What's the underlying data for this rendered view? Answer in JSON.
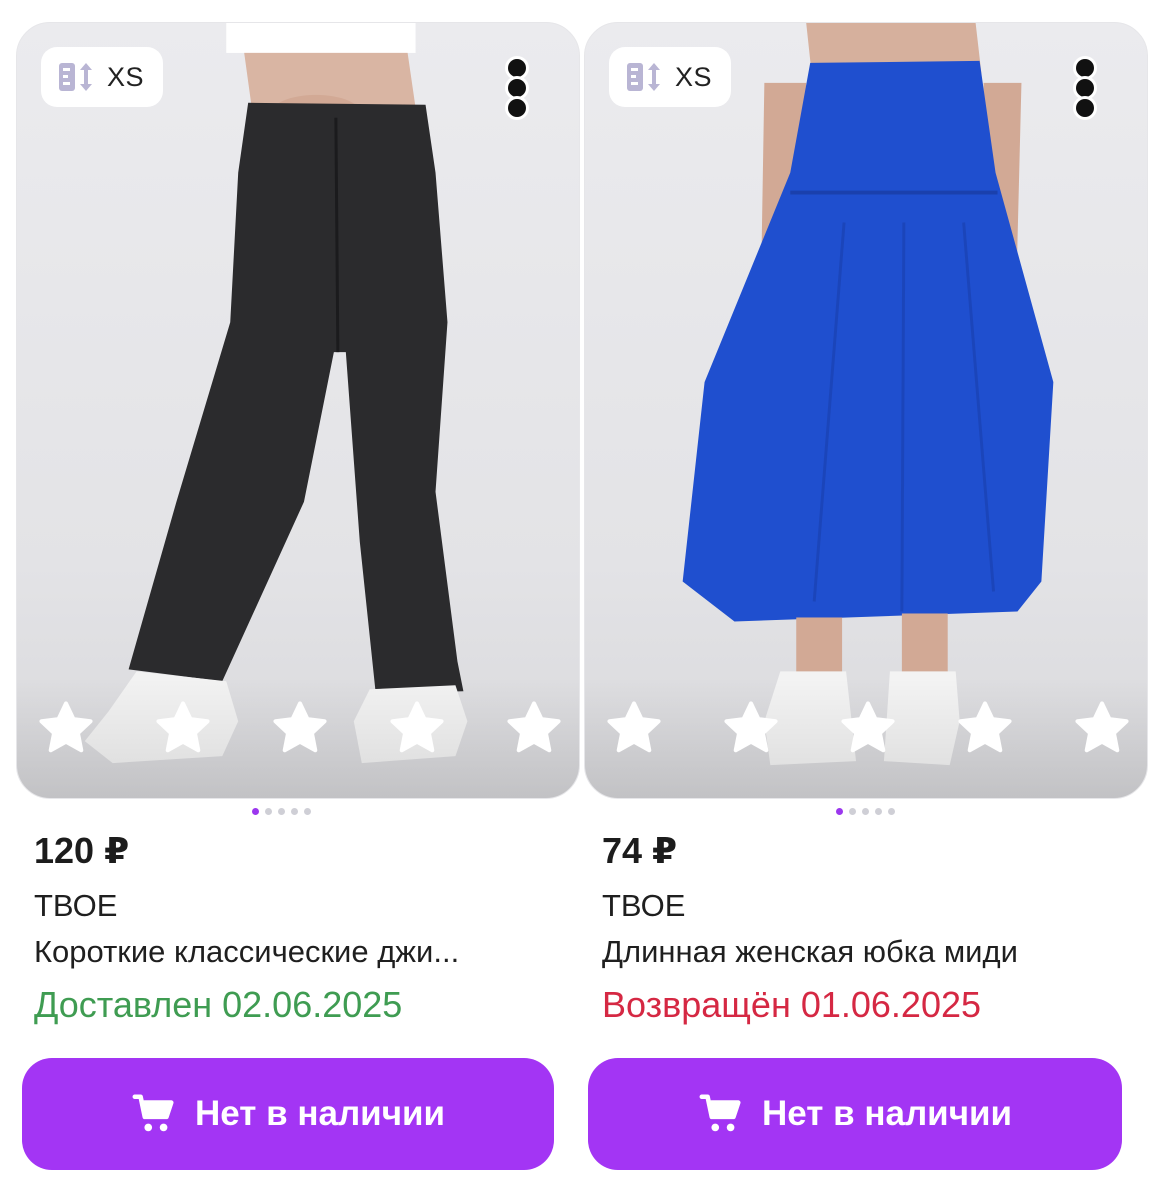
{
  "products": [
    {
      "size_badge": {
        "icon": "size-ruler-icon",
        "label": "XS"
      },
      "menu_icon": "more-vertical-icon",
      "image": {
        "description": "black flared jeans",
        "garment_color": "#2b2b2d"
      },
      "rating_stars": 5,
      "gallery": {
        "count": 5,
        "active": 0
      },
      "price": "120 ₽",
      "brand": "ТВОЕ",
      "title": "Короткие классические джи...",
      "status": "Доставлен 02.06.2025",
      "status_color": "#3f9c52",
      "button": {
        "icon": "cart-icon",
        "label": "Нет в наличии"
      }
    },
    {
      "size_badge": {
        "icon": "size-ruler-icon",
        "label": "XS"
      },
      "menu_icon": "more-vertical-icon",
      "image": {
        "description": "blue midi skirt",
        "garment_color": "#1f4fcf"
      },
      "rating_stars": 5,
      "gallery": {
        "count": 5,
        "active": 0
      },
      "price": "74 ₽",
      "brand": "ТВОЕ",
      "title": "Длинная женская юбка миди",
      "status": "Возвращён 01.06.2025",
      "status_color": "#d52843",
      "button": {
        "icon": "cart-icon",
        "label": "Нет в наличии"
      }
    }
  ],
  "colors": {
    "accent": "#a335f4",
    "dot_active": "#9b37ee",
    "delivered": "#3f9c52",
    "returned": "#d52843"
  }
}
